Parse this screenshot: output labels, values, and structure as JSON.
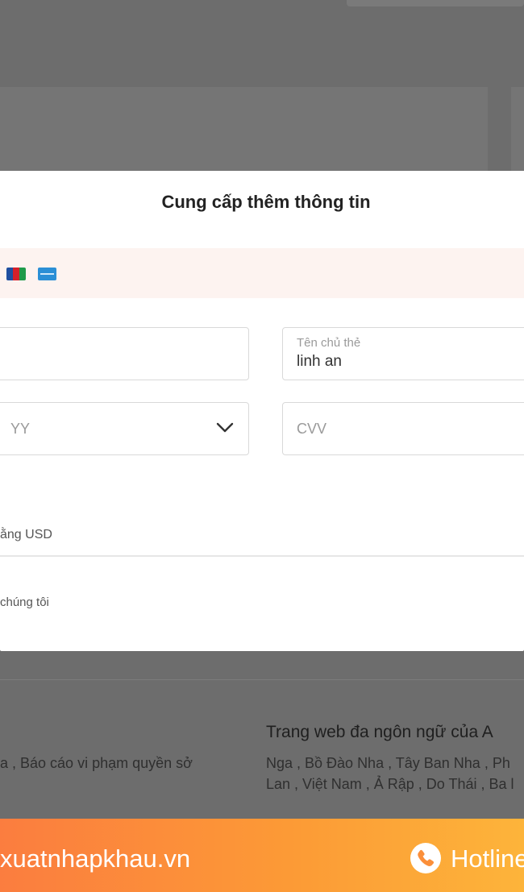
{
  "modal": {
    "title": "Cung cấp thêm thông tin",
    "card_logos": [
      "jcb-logo",
      "amex-logo"
    ],
    "fields": {
      "card_number": {
        "value": ""
      },
      "holder": {
        "label": "Tên chủ thẻ",
        "value": "linh an"
      },
      "expiry_year": {
        "placeholder": "YY"
      },
      "cvv": {
        "placeholder": "CVV"
      }
    },
    "currency_note": "ằng USD",
    "terms_note": "chúng tôi"
  },
  "background": {
    "footer_left": "a , Báo cáo vi phạm quyền sở",
    "footer_title": "Trang web đa ngôn ngữ của A",
    "footer_line1": "Nga , Bồ Đào Nha , Tây Ban Nha , Ph",
    "footer_line2": "Lan , Việt Nam , Ả Rập , Do Thái , Ba l"
  },
  "banner": {
    "site": "xuatnhapkhau.vn",
    "hotline": "Hotline"
  },
  "colors": {
    "overlay": "#6d6d6d",
    "card_strip": "#fdf3f0",
    "banner_start": "#fb7d3f",
    "banner_end": "#fdb43a"
  }
}
